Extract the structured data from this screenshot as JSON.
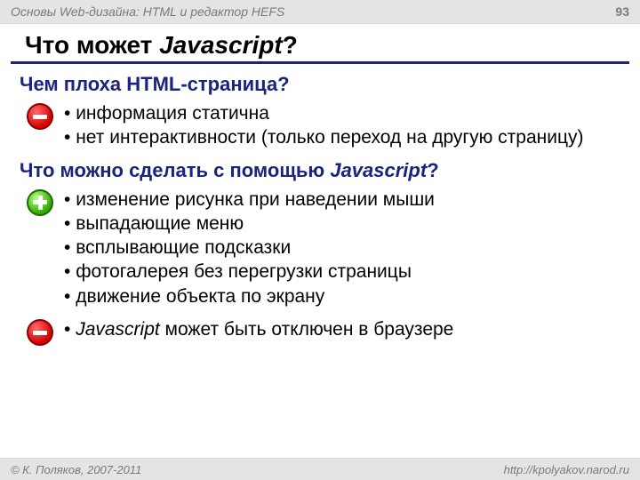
{
  "header": {
    "course": "Основы Web-дизайна: HTML и редактор HEFS",
    "page_number": "93"
  },
  "title": {
    "prefix": "Что может ",
    "topic": "Javascript",
    "q": "?"
  },
  "section1": {
    "heading": "Чем плоха HTML-страница?",
    "items": [
      "информация статична",
      "нет интерактивности (только переход на другую страницу)"
    ]
  },
  "section2": {
    "heading_prefix": "Что можно сделать с помощью ",
    "heading_topic": "Javascript",
    "heading_q": "?",
    "items": [
      "изменение рисунка при наведении мыши",
      "выпадающие меню",
      "всплывающие подсказки",
      "фотогалерея без перегрузки страницы",
      "движение объекта по экрану"
    ]
  },
  "section3": {
    "item_topic": "Javascript",
    "item_rest": " может быть отключен в браузере"
  },
  "footer": {
    "copyright": "© К. Поляков, 2007-2011",
    "url": "http://kpolyakov.narod.ru"
  }
}
